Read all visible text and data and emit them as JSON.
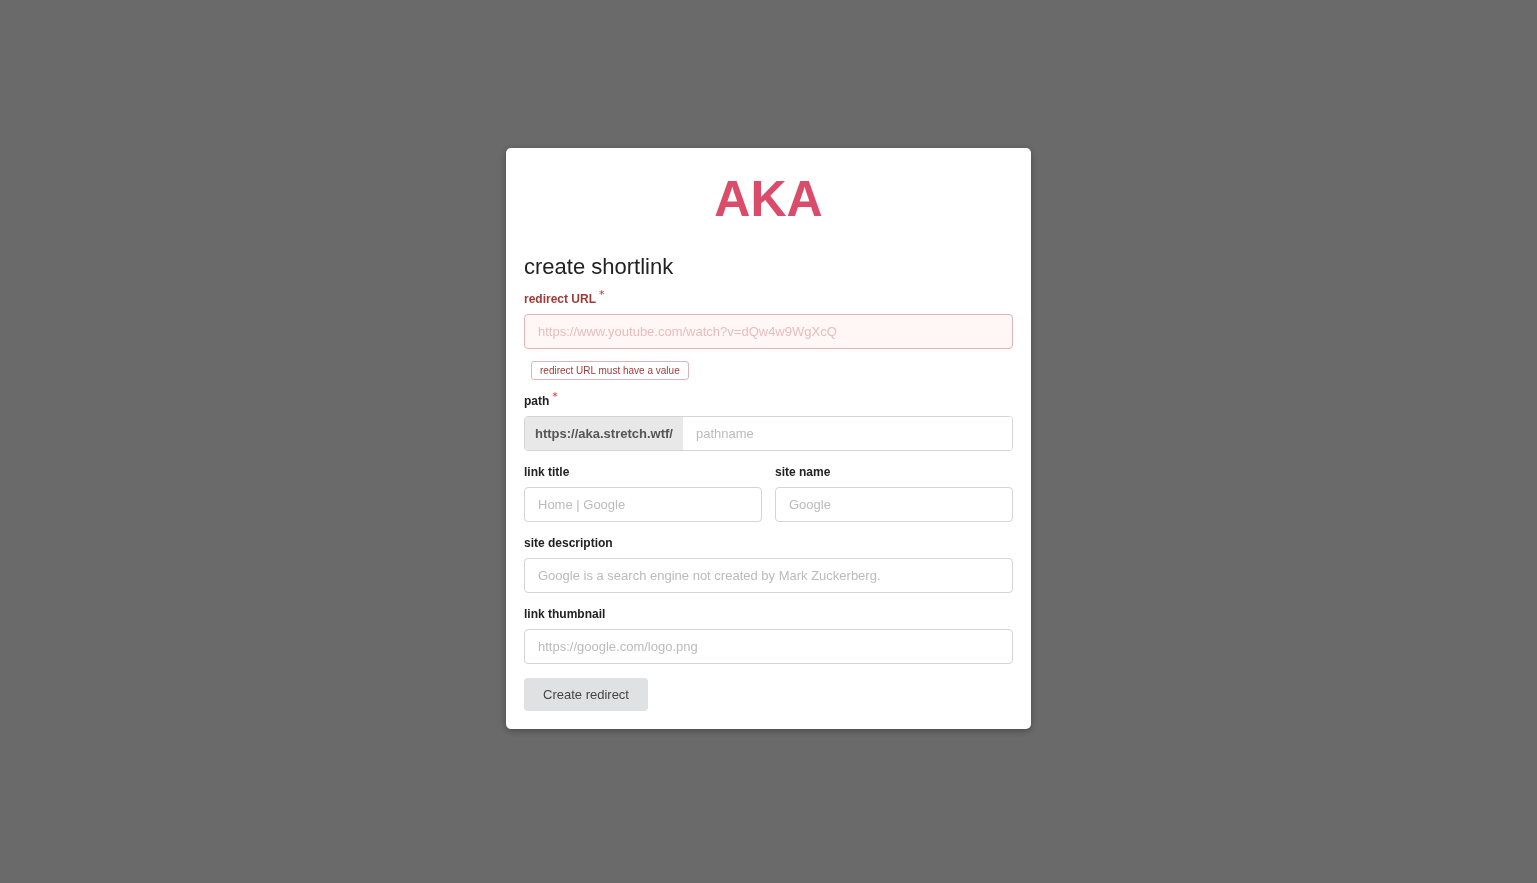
{
  "logo": "AKA",
  "heading": "create shortlink",
  "rows": [
    {
      "fields": [
        {
          "kind": "text",
          "label": "redirect URL",
          "required_mark": "*",
          "placeholder": "https://www.youtube.com/watch?v=dQw4w9WgXcQ",
          "error": true,
          "error_message": "redirect URL must have a value"
        }
      ]
    },
    {
      "fields": [
        {
          "kind": "prefixed",
          "label": "path",
          "required_mark": "*",
          "prefix": "https://aka.stretch.wtf/",
          "placeholder": "pathname",
          "error": false
        }
      ]
    },
    {
      "fields": [
        {
          "kind": "text",
          "label": "link title",
          "placeholder": "Home | Google",
          "error": false
        },
        {
          "kind": "text",
          "label": "site name",
          "placeholder": "Google",
          "error": false
        }
      ]
    },
    {
      "fields": [
        {
          "kind": "text",
          "label": "site description",
          "placeholder": "Google is a search engine not created by Mark Zuckerberg.",
          "error": false
        }
      ]
    },
    {
      "fields": [
        {
          "kind": "text",
          "label": "link thumbnail",
          "placeholder": "https://google.com/logo.png",
          "error": false
        }
      ]
    }
  ],
  "submit": {
    "label": "Create redirect"
  }
}
